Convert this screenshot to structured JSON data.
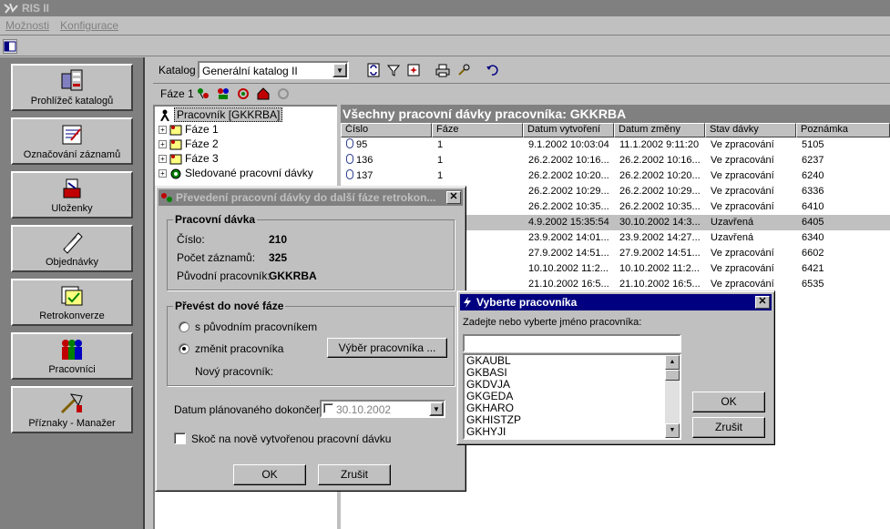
{
  "app": {
    "title": "RIS II"
  },
  "menu": {
    "items": [
      "Možnosti",
      "Konfigurace"
    ]
  },
  "nav": {
    "items": [
      {
        "label": "Prohlížeč katalogů",
        "icon": "catalog-browser-icon"
      },
      {
        "label": "Označování záznamů",
        "icon": "record-marking-icon"
      },
      {
        "label": "Uloženky",
        "icon": "saved-items-icon"
      },
      {
        "label": "Objednávky",
        "icon": "orders-icon"
      },
      {
        "label": "Retrokonverze",
        "icon": "retroconversion-icon"
      },
      {
        "label": "Pracovníci",
        "icon": "workers-icon"
      },
      {
        "label": "Příznaky - Manažer",
        "icon": "flags-manager-icon"
      }
    ]
  },
  "catalog": {
    "label": "Katalog",
    "selected": "Generální katalog II"
  },
  "faze": {
    "label": "Fáze 1"
  },
  "tree": {
    "items": [
      {
        "label": "Pracovník [GKKRBA]"
      },
      {
        "label": "Fáze 1"
      },
      {
        "label": "Fáze 2"
      },
      {
        "label": "Fáze 3"
      },
      {
        "label": "Sledované pracovní dávky"
      }
    ]
  },
  "list": {
    "title": "Všechny pracovní dávky pracovníka: GKKRBA",
    "columns": [
      "Číslo",
      "Fáze",
      "Datum vytvoření",
      "Datum změny",
      "Stav dávky",
      "Poznámka"
    ],
    "rows": [
      {
        "cislo": "95",
        "faze": "1",
        "vytvoreni": "9.1.2002 10:03:04",
        "zmena": "11.1.2002 9:11:20",
        "stav": "Ve zpracování",
        "poznamka": "5105"
      },
      {
        "cislo": "136",
        "faze": "1",
        "vytvoreni": "26.2.2002 10:16...",
        "zmena": "26.2.2002 10:16...",
        "stav": "Ve zpracování",
        "poznamka": "6237"
      },
      {
        "cislo": "137",
        "faze": "1",
        "vytvoreni": "26.2.2002 10:20...",
        "zmena": "26.2.2002 10:20...",
        "stav": "Ve zpracování",
        "poznamka": "6240"
      },
      {
        "cislo": "",
        "faze": "",
        "vytvoreni": "26.2.2002 10:29...",
        "zmena": "26.2.2002 10:29...",
        "stav": "Ve zpracování",
        "poznamka": "6336"
      },
      {
        "cislo": "",
        "faze": "",
        "vytvoreni": "26.2.2002 10:35...",
        "zmena": "26.2.2002 10:35...",
        "stav": "Ve zpracování",
        "poznamka": "6410"
      },
      {
        "cislo": "",
        "faze": "",
        "vytvoreni": "4.9.2002 15:35:54",
        "zmena": "30.10.2002 14:3...",
        "stav": "Uzavřená",
        "poznamka": "6405"
      },
      {
        "cislo": "",
        "faze": "",
        "vytvoreni": "23.9.2002 14:01...",
        "zmena": "23.9.2002 14:27...",
        "stav": "Uzavřená",
        "poznamka": "6340"
      },
      {
        "cislo": "",
        "faze": "",
        "vytvoreni": "27.9.2002 14:51...",
        "zmena": "27.9.2002 14:51...",
        "stav": "Ve zpracování",
        "poznamka": "6602"
      },
      {
        "cislo": "",
        "faze": "",
        "vytvoreni": "10.10.2002 11:2...",
        "zmena": "10.10.2002 11:2...",
        "stav": "Ve zpracování",
        "poznamka": "6421"
      },
      {
        "cislo": "",
        "faze": "",
        "vytvoreni": "21.10.2002 16:5...",
        "zmena": "21.10.2002 16:5...",
        "stav": "Ve zpracování",
        "poznamka": "6535"
      }
    ]
  },
  "dialog_prevod": {
    "title": "Převedení pracovní dávky do další fáze retrokon...",
    "group1_title": "Pracovní dávka",
    "cislo_label": "Číslo:",
    "cislo_value": "210",
    "pocet_label": "Počet záznamů:",
    "pocet_value": "325",
    "puvodni_label": "Původní pracovník:",
    "puvodni_value": "GKKRBA",
    "group2_title": "Převést do nové fáze",
    "radio1": "s původním pracovníkem",
    "radio2": "změnit pracovníka",
    "vyber_button": "Výběr pracovníka ...",
    "novy_label": "Nový pracovník:",
    "datum_label": "Datum plánovaného dokončení:",
    "datum_value": "30.10.2002",
    "skoc_label": "Skoč na nově vytvořenou pracovní dávku",
    "ok": "OK",
    "zrusit": "Zrušit"
  },
  "dialog_vyber": {
    "title": "Vyberte pracovníka",
    "prompt": "Zadejte nebo vyberte jméno pracovníka:",
    "input_value": "",
    "items": [
      "GKAUBL",
      "GKBASI",
      "GKDVJA",
      "GKGEDA",
      "GKHARO",
      "GKHISTZP",
      "GKHYJI"
    ],
    "ok": "OK",
    "zrusit": "Zrušit"
  }
}
